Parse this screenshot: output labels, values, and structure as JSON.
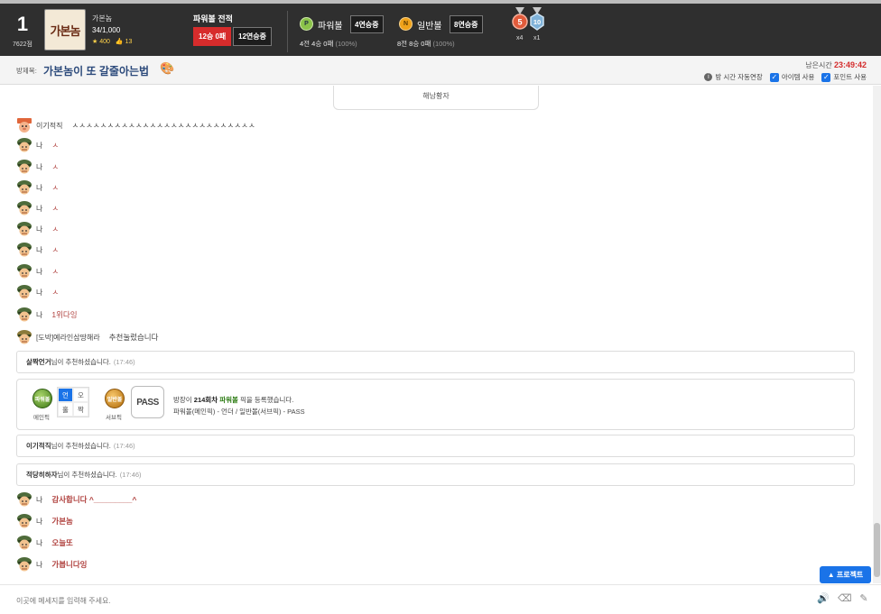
{
  "profile": {
    "rank": "1",
    "rank_points": "7622점",
    "avatar_text": "가본놈",
    "name": "가본놈",
    "exp": "34/1,000",
    "stars": "400",
    "likes": "13"
  },
  "powerball_record": {
    "title": "파워볼 전적",
    "lose_label": "12승 0패",
    "streak_label": "12연승중"
  },
  "games": {
    "power": {
      "icon_letter": "P",
      "label": "파워볼",
      "streak": "4연승중",
      "record": "4전 4승 0패",
      "pct": "(100%)"
    },
    "normal": {
      "icon_letter": "N",
      "label": "일반볼",
      "streak": "8연승중",
      "record": "8전 8승 0패",
      "pct": "(100%)"
    }
  },
  "medals": [
    {
      "number": "5",
      "count": "x4",
      "color": "#e25b3b"
    },
    {
      "number": "10",
      "count": "x1",
      "color": "#7fb2d9"
    }
  ],
  "room": {
    "label": "방제목:",
    "title": "가본놈이 또 갈줄아는법",
    "emoji": "🎨",
    "remain_label": "남은시간",
    "remain_time": "23:49:42",
    "option_extend": "방 시간 자동연장",
    "option_item": "아이템 사용",
    "option_point": "포인트 사용"
  },
  "chat": {
    "cut_card_text": "해남황자",
    "messages": [
      {
        "name": "이기적직",
        "text": "ㅅㅅㅅㅅㅅㅅㅅㅅㅅㅅㅅㅅㅅㅅㅅㅅㅅㅅㅅㅅㅅㅅㅅㅅㅅㅅ",
        "style": "dark",
        "avatar": "pig"
      },
      {
        "name": "나",
        "text": "ㅅ",
        "style": "",
        "avatar": "soldier"
      },
      {
        "name": "나",
        "text": "ㅅ",
        "style": "",
        "avatar": "soldier"
      },
      {
        "name": "나",
        "text": "ㅅ",
        "style": "",
        "avatar": "soldier"
      },
      {
        "name": "나",
        "text": "ㅅ",
        "style": "",
        "avatar": "soldier"
      },
      {
        "name": "나",
        "text": "ㅅ",
        "style": "",
        "avatar": "soldier"
      },
      {
        "name": "나",
        "text": "ㅅ",
        "style": "",
        "avatar": "soldier"
      },
      {
        "name": "나",
        "text": "ㅅ",
        "style": "",
        "avatar": "soldier"
      },
      {
        "name": "나",
        "text": "ㅅ",
        "style": "",
        "avatar": "soldier"
      },
      {
        "name": "나",
        "text": "1위다잉",
        "style": "",
        "avatar": "soldier"
      },
      {
        "name": "[도박]예라인삼땅해라",
        "text": "추천눌렀습니다",
        "style": "dark",
        "avatar": "soldier2"
      }
    ],
    "sys1": {
      "who": "살짝언거",
      "text": "님이 추천하셨습니다.",
      "time": "(17:46)"
    },
    "pick": {
      "power_ball": "파워볼",
      "power_cap": "메인픽",
      "grid": [
        "언",
        "오",
        "홀",
        "짝"
      ],
      "normal_ball": "일반볼",
      "normal_cap": "서브픽",
      "pass": "PASS",
      "line1_pre": "방장이 ",
      "line1_round": "214회차",
      "line1_game": "파워볼",
      "line1_post": " 픽을 등록했습니다.",
      "line2": "파워볼(메인픽) - 언더 / 일반볼(서브픽) - PASS"
    },
    "sys2": {
      "who": "이기적직",
      "text": "님이 추천하셨습니다.",
      "time": "(17:46)"
    },
    "sys3": {
      "who": "적당히하자",
      "text": "님이 추천하셨습니다.",
      "time": "(17:46)"
    },
    "messages2": [
      {
        "name": "나",
        "text": "감사합니다 ^_________^"
      },
      {
        "name": "나",
        "text": "가본놈"
      },
      {
        "name": "나",
        "text": "오늘또"
      },
      {
        "name": "나",
        "text": "가봅니다잉"
      }
    ]
  },
  "protect_button": "▲ 프로젝트",
  "input": {
    "placeholder": "이곳에 메세지를 입력해 주세요."
  }
}
